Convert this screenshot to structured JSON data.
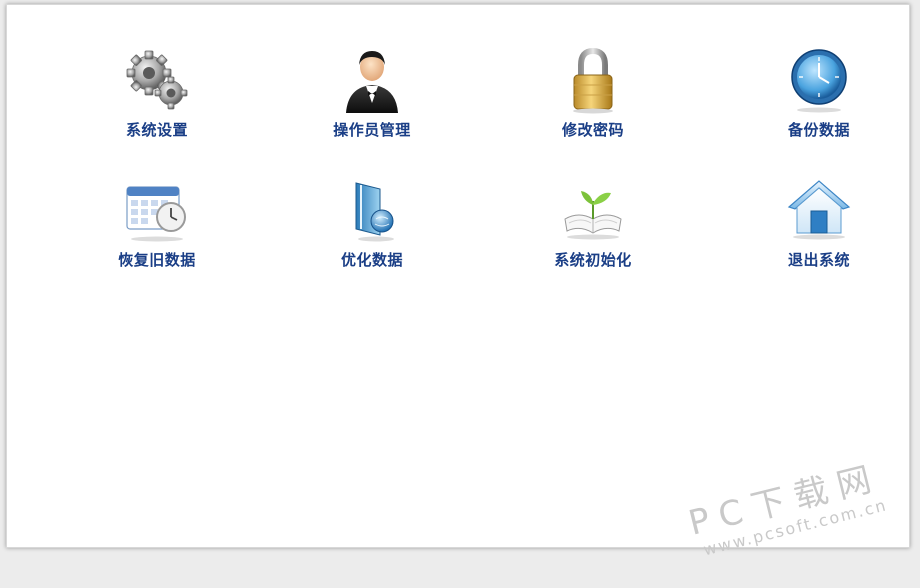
{
  "menu": {
    "items": [
      {
        "label": "系统设置",
        "icon": "gears-icon"
      },
      {
        "label": "操作员管理",
        "icon": "operator-icon"
      },
      {
        "label": "修改密码",
        "icon": "padlock-icon"
      },
      {
        "label": "备份数据",
        "icon": "clock-icon"
      },
      {
        "label": "恢复旧数据",
        "icon": "calendar-clock-icon"
      },
      {
        "label": "优化数据",
        "icon": "book-globe-icon"
      },
      {
        "label": "系统初始化",
        "icon": "book-sprout-icon"
      },
      {
        "label": "退出系统",
        "icon": "house-icon"
      }
    ]
  },
  "watermark": {
    "main": "PC下载网",
    "url": "www.pcsoft.com.cn"
  },
  "colors": {
    "label": "#1a3e86",
    "background": "#ffffff"
  }
}
